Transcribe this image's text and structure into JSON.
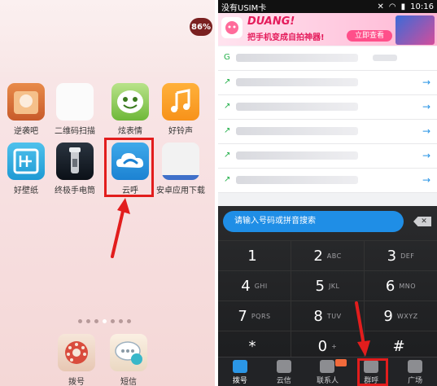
{
  "left": {
    "battery_badge": "86%",
    "apps_row1": [
      {
        "label": "逆袭吧",
        "icon": "nixi-app-icon"
      },
      {
        "label": "二维码扫描",
        "icon": "qr-scanner-icon"
      },
      {
        "label": "炫表情",
        "icon": "smiley-face-icon"
      },
      {
        "label": "好铃声",
        "icon": "music-note-icon"
      }
    ],
    "apps_row2": [
      {
        "label": "好壁纸",
        "icon": "wallpaper-icon"
      },
      {
        "label": "终极手电筒",
        "icon": "flashlight-icon"
      },
      {
        "label": "云呼",
        "icon": "cloud-phone-icon"
      },
      {
        "label": "安卓应用下载",
        "icon": "app-store-icon"
      }
    ],
    "dock": [
      {
        "label": "拨号",
        "icon": "rotary-dial-icon"
      },
      {
        "label": "短信",
        "icon": "chat-bubble-icon"
      }
    ]
  },
  "right": {
    "status": {
      "carrier": "没有USIM卡",
      "time": "10:16"
    },
    "banner": {
      "headline": "DUANG!",
      "tagline": "把手机变成自拍神器!",
      "button": "立即查看"
    },
    "search_placeholder": "请输入号码或拼音搜索",
    "keys": [
      [
        {
          "n": "1",
          "s": ""
        },
        {
          "n": "2",
          "s": "ABC"
        },
        {
          "n": "3",
          "s": "DEF"
        }
      ],
      [
        {
          "n": "4",
          "s": "GHI"
        },
        {
          "n": "5",
          "s": "JKL"
        },
        {
          "n": "6",
          "s": "MNO"
        }
      ],
      [
        {
          "n": "7",
          "s": "PQRS"
        },
        {
          "n": "8",
          "s": "TUV"
        },
        {
          "n": "9",
          "s": "WXYZ"
        }
      ],
      [
        {
          "n": "*",
          "s": ""
        },
        {
          "n": "0",
          "s": "+"
        },
        {
          "n": "#",
          "s": ""
        }
      ]
    ],
    "tabs": [
      "拨号",
      "云信",
      "联系人",
      "群呼",
      "广场"
    ]
  },
  "colors": {
    "highlight_red": "#e21d1d",
    "accent_blue": "#2b96e6"
  }
}
